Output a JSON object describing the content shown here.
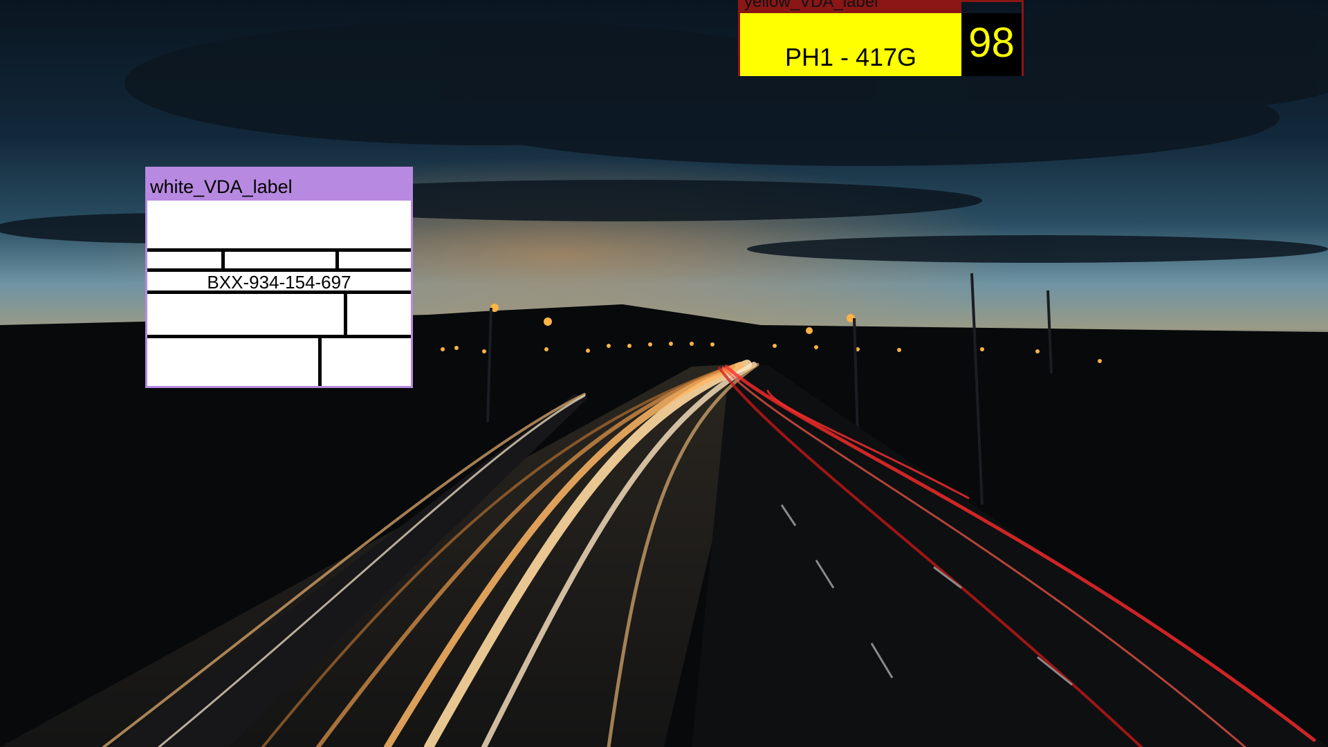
{
  "scene": {
    "description_icon": "night-highway-light-trails",
    "colors": {
      "sky_top": "#0b1722",
      "sky_horizon": "#6f93a3",
      "sunset_glow": "#c88a45",
      "ground": "#07090b",
      "warm_trail": "#ffb15c",
      "red_trail": "#e02020"
    }
  },
  "annotations": {
    "yellow": {
      "caption": "yellow_VDA_label",
      "plate_text": "PH1 - 417G",
      "score": "98",
      "colors": {
        "border": "#8a1616",
        "plate": "#ffff00",
        "score_bg": "#000000",
        "score_text": "#ffff00"
      }
    },
    "white": {
      "caption": "white_VDA_label",
      "id_text": "BXX-934-154-697",
      "colors": {
        "border": "#b889e0",
        "fill": "#ffffff"
      }
    }
  }
}
